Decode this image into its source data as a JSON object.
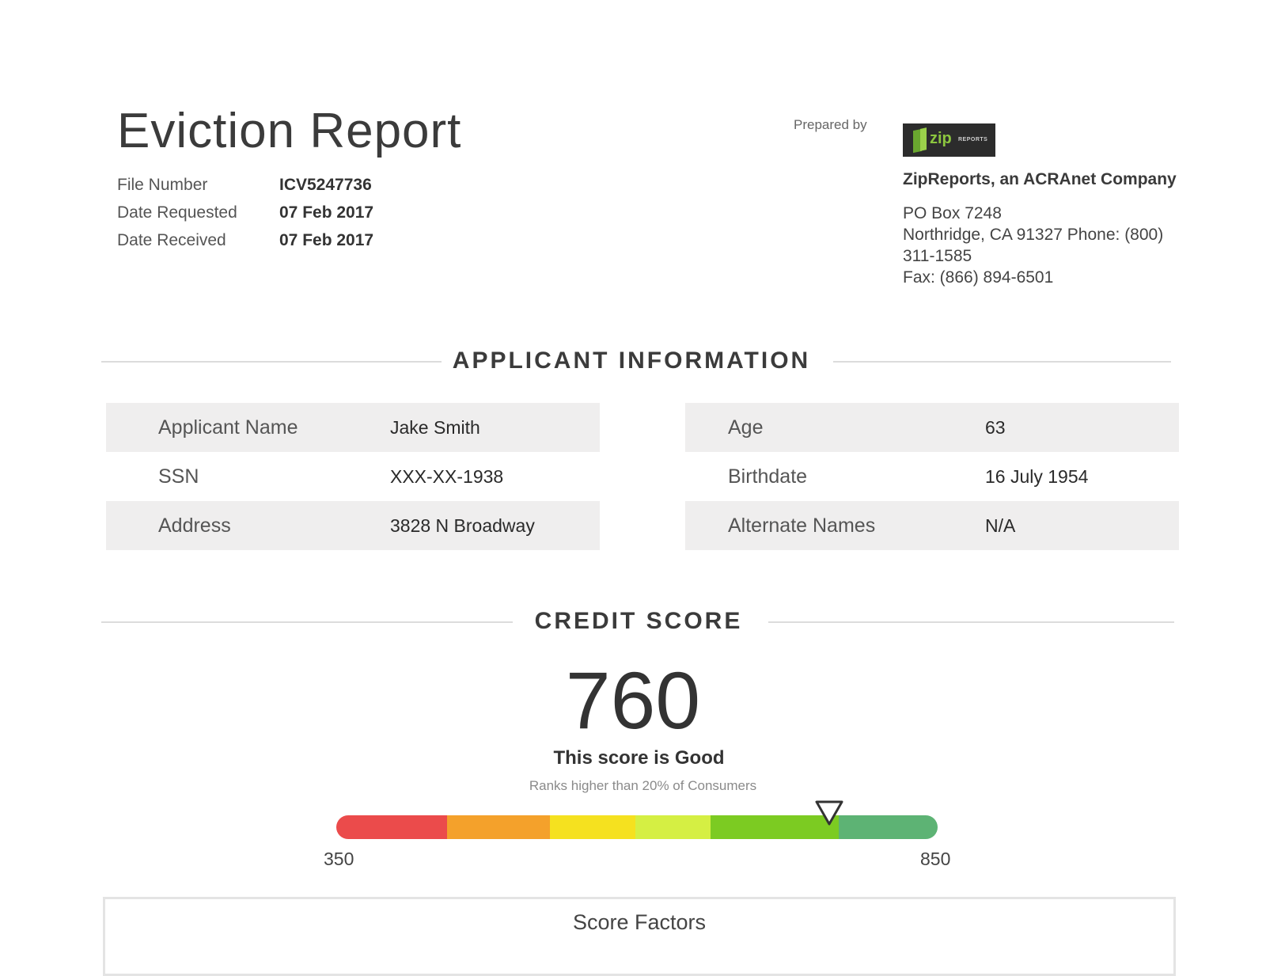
{
  "report": {
    "title": "Eviction Report",
    "meta": [
      {
        "label": "File Number",
        "value": "ICV5247736"
      },
      {
        "label": "Date Requested",
        "value": "07 Feb 2017"
      },
      {
        "label": "Date Received",
        "value": "07 Feb 2017"
      }
    ]
  },
  "preparer": {
    "label": "Prepared by",
    "logo_text": "zip",
    "logo_subtext": "REPORTS",
    "company": "ZipReports, an ACRAnet Company",
    "address_line1": "PO Box 7248",
    "address_line2": "Northridge, CA 91327 Phone: (800) 311-1585",
    "fax": "Fax: (866) 894-6501"
  },
  "applicant_section": {
    "heading": "APPLICANT INFORMATION",
    "left": [
      {
        "label": "Applicant Name",
        "value": "Jake Smith"
      },
      {
        "label": "SSN",
        "value": "XXX-XX-1938"
      },
      {
        "label": "Address",
        "value": "3828 N Broadway"
      }
    ],
    "right": [
      {
        "label": "Age",
        "value": "63"
      },
      {
        "label": "Birthdate",
        "value": "16 July 1954"
      },
      {
        "label": "Alternate Names",
        "value": "N/A"
      }
    ]
  },
  "credit_section": {
    "heading": "CREDIT SCORE",
    "score": "760",
    "caption": "This score is Good",
    "rank": "Ranks higher than 20% of Consumers",
    "gauge": {
      "min": "350",
      "max": "850",
      "value": 760,
      "colors": [
        "#eb4b4b",
        "#f4a12b",
        "#f5e11f",
        "#d5ef43",
        "#7ccb22",
        "#5db374"
      ]
    },
    "factors_title": "Score Factors"
  }
}
